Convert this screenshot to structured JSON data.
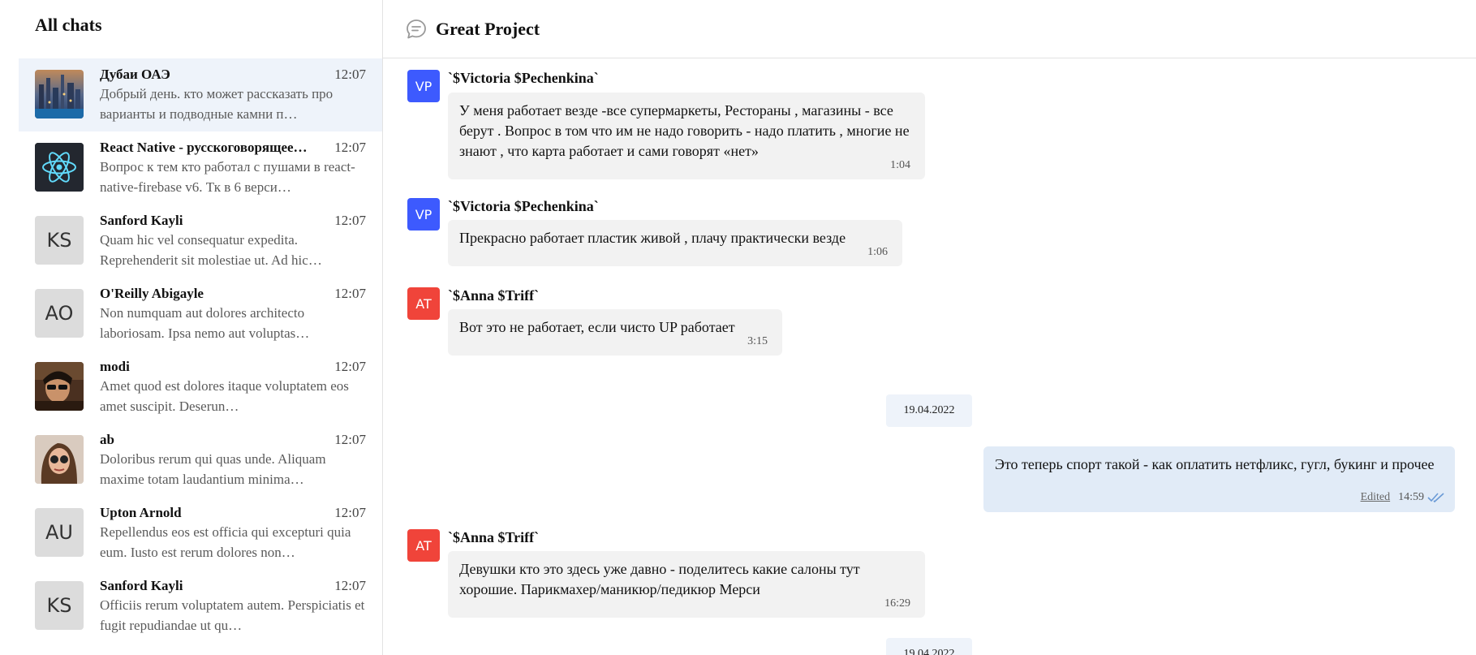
{
  "sidebar": {
    "title": "All chats",
    "chats": [
      {
        "name": "Дубаи ОАЭ",
        "time": "12:07",
        "preview": "Добрый день. кто может рассказать про варианты и подводные камни п…",
        "avatar": "photo-city"
      },
      {
        "name": "React Native - русскоговорящее…",
        "time": "12:07",
        "preview": "Вопрос к тем кто работал с пушами в react-native-firebase v6. Тк в 6 верси…",
        "avatar": "react-logo"
      },
      {
        "name": "Sanford Kayli",
        "time": "12:07",
        "preview": "Quam hic vel consequatur expedita. Reprehenderit sit molestiae ut. Ad hic…",
        "initials": "KS"
      },
      {
        "name": "O'Reilly Abigayle",
        "time": "12:07",
        "preview": "Non numquam aut dolores architecto laboriosam. Ipsa nemo aut voluptas…",
        "initials": "AO"
      },
      {
        "name": "modi",
        "time": "12:07",
        "preview": "Amet quod est dolores itaque voluptatem eos amet suscipit. Deserun…",
        "avatar": "photo-man"
      },
      {
        "name": "ab",
        "time": "12:07",
        "preview": "Doloribus rerum qui quas unde. Aliquam maxime totam laudantium minima…",
        "avatar": "photo-woman"
      },
      {
        "name": "Upton Arnold",
        "time": "12:07",
        "preview": "Repellendus eos est officia qui excepturi quia eum. Iusto est rerum dolores non…",
        "initials": "AU"
      },
      {
        "name": "Sanford Kayli",
        "time": "12:07",
        "preview": "Officiis rerum voluptatem autem. Perspiciatis et fugit repudiandae ut qu…",
        "initials": "KS"
      }
    ]
  },
  "header": {
    "title": "Great Project",
    "icon": "chat-bubble-icon"
  },
  "messages": [
    {
      "sender": "`$Victoria $Pechenkina`",
      "initials": "VP",
      "avatar_color": "#3d5afe",
      "text": "У меня работает везде -все супермаркеты, Рестораны , магазины - все берут . Вопрос в том что им не надо говорить - надо платить , многие не знают , что карта работает и сами говорят «нет»",
      "time": "1:04"
    },
    {
      "sender": "`$Victoria $Pechenkina`",
      "initials": "VP",
      "avatar_color": "#3d5afe",
      "text": "Прекрасно работает пластик живой , плачу практически везде",
      "time": "1:06"
    },
    {
      "sender": "`$Anna $Triff`",
      "initials": "AT",
      "avatar_color": "#f0443a",
      "text": "Вот это не работает, если чисто UP работает",
      "time": "3:15"
    },
    {
      "sender": "`$Anna $Triff`",
      "initials": "AT",
      "avatar_color": "#f0443a",
      "text": "Девушки кто это здесь уже давно - поделитесь какие салоны тут хорошие. Парикмахер/маникюр/педикюр Мерси",
      "time": "16:29"
    }
  ],
  "dates": [
    "19.04.2022",
    "19.04.2022"
  ],
  "own_message": {
    "text": "Это теперь спорт такой - как оплатить нетфликс, гугл, букинг и прочее",
    "edited_label": "Edited",
    "time": "14:59",
    "status_icon": "double-check-icon",
    "status_color": "#6a9ad6"
  },
  "colors": {
    "active_chat_bg": "#eef3fa",
    "bubble_bg": "#f2f2f2",
    "own_bubble_bg": "#e1ebf7"
  }
}
